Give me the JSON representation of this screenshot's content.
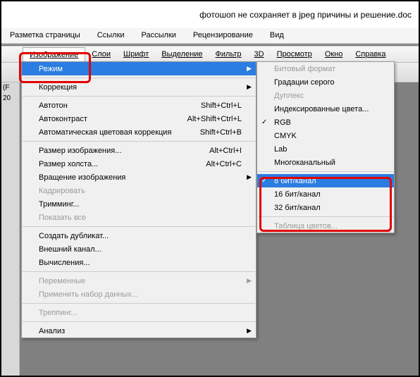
{
  "title": "фотошоп не сохраняет в jpeg причины и решение.doc",
  "winmenu": [
    "Разметка страницы",
    "Ссылки",
    "Рассылки",
    "Рецензирование",
    "Вид"
  ],
  "psmenu": [
    "Изображение",
    "Слои",
    "Шрифт",
    "Выделение",
    "Фильтр",
    "3D",
    "Просмотр",
    "Окно",
    "Справка"
  ],
  "side": {
    "l1": "(F",
    "l2": "20"
  },
  "dd": {
    "mode": "Режим",
    "corr": "Коррекция",
    "auto_tone": {
      "l": "Автотон",
      "s": "Shift+Ctrl+L"
    },
    "auto_contrast": {
      "l": "Автоконтраст",
      "s": "Alt+Shift+Ctrl+L"
    },
    "auto_color": {
      "l": "Автоматическая цветовая коррекция",
      "s": "Shift+Ctrl+B"
    },
    "img_size": {
      "l": "Размер изображения...",
      "s": "Alt+Ctrl+I"
    },
    "canvas": {
      "l": "Размер холста...",
      "s": "Alt+Ctrl+C"
    },
    "rotate": "Вращение изображения",
    "crop": "Кадрировать",
    "trim": "Тримминг...",
    "show": "Показать все",
    "dup": "Создать дубликат...",
    "apply": "Внешний канал...",
    "calc": "Вычисления...",
    "vars": "Переменные",
    "dataset": "Применить набор данных...",
    "trap": "Треппинг...",
    "analysis": "Анализ"
  },
  "sm": {
    "bitmap": "Битовый формат",
    "gray": "Градации серого",
    "duotone": "Дуплекс",
    "indexed": "Индексированные цвета...",
    "rgb": "RGB",
    "cmyk": "CMYK",
    "lab": "Lab",
    "multi": "Многоканальный",
    "bit8": "8 бит/канал",
    "bit16": "16 бит/канал",
    "bit32": "32 бит/канал",
    "ctable": "Таблица цветов..."
  }
}
